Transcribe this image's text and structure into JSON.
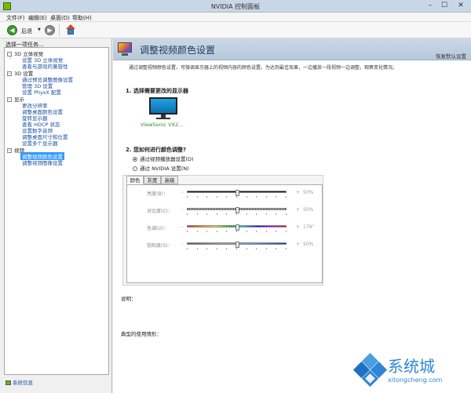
{
  "window": {
    "title": "NVIDIA 控制面板",
    "min": "–",
    "max": "☐",
    "close": "✕"
  },
  "menubar": {
    "items": [
      "文件(F)",
      "编辑(E)",
      "桌面(D)",
      "帮助(H)"
    ]
  },
  "toolbar": {
    "back_label": "后退",
    "back_icon": "◀",
    "forward_icon": "▶",
    "dropdown": "▼"
  },
  "left": {
    "heading": "选择一项任务...",
    "tree": [
      {
        "label": "3D 立体视觉",
        "children": [
          "设置 3D 立体视觉",
          "查看与游戏的兼容性"
        ]
      },
      {
        "label": "3D 设置",
        "children": [
          "通过预览调整图像设置",
          "管理 3D 设置",
          "设置 PhysX 配置"
        ]
      },
      {
        "label": "显示",
        "children": [
          "更改分辨率",
          "调整桌面颜色设置",
          "旋转显示器",
          "查看 HDCP 状态",
          "设置数字音频",
          "调整桌面尺寸和位置",
          "设置多个显示器"
        ]
      },
      {
        "label": "视频",
        "children": [
          "调整视频颜色设置",
          "调整视频图像设置"
        ]
      }
    ],
    "selected": "调整视频颜色设置",
    "system_info": "系统信息"
  },
  "main": {
    "title": "调整视频颜色设置",
    "restore": "恢复默认设置",
    "description": "通过调整视频颜色设置，可微调显示器上的视频内容的颜色设置。为达到最佳效果，一边播放一段视频一边调整，观察变化情况。",
    "section1": "1. 选择需要更改的显示器",
    "monitor_label": "ViewSonic VX2...",
    "section2": "2. 您如何进行颜色调整?",
    "radio1": "通过视频播放器设置(D)",
    "radio2": "通过 NVIDIA 设置(N)",
    "radio_selected": 1,
    "tabs": [
      "颜色",
      "灰度",
      "高级"
    ],
    "sliders": [
      {
        "label": "亮度(B)：",
        "value": "50%",
        "level": 0.5,
        "style": "dark"
      },
      {
        "label": "对比度(C)：",
        "value": "50%",
        "level": 0.5,
        "style": "dotted"
      },
      {
        "label": "色调(U)：",
        "value": "179°",
        "level": 0.5,
        "style": "rainbow"
      },
      {
        "label": "饱和度(S)：",
        "value": "50%",
        "level": 0.5,
        "style": "sat"
      }
    ],
    "minus": "-",
    "plus": "+",
    "description_label": "说明：",
    "usage_label": "典型的使用情形："
  },
  "watermark": {
    "brand": "系统城",
    "url": "xitongcheng.com"
  }
}
